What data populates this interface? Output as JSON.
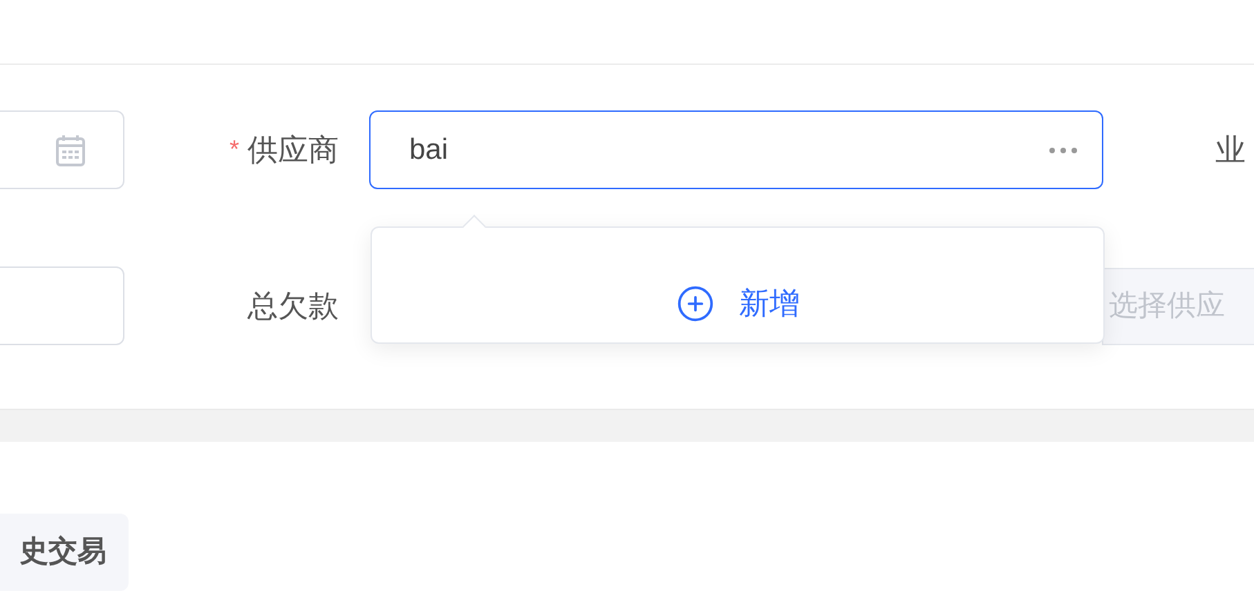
{
  "form": {
    "supplier": {
      "label": "供应商",
      "required_mark": "*",
      "value": "bai"
    },
    "total_debt": {
      "label": "总欠款"
    },
    "next_label": "业",
    "supplier_select": {
      "placeholder": "选择供应",
      "disabled": true
    }
  },
  "dropdown": {
    "action": "新增"
  },
  "history_button": "史交易"
}
